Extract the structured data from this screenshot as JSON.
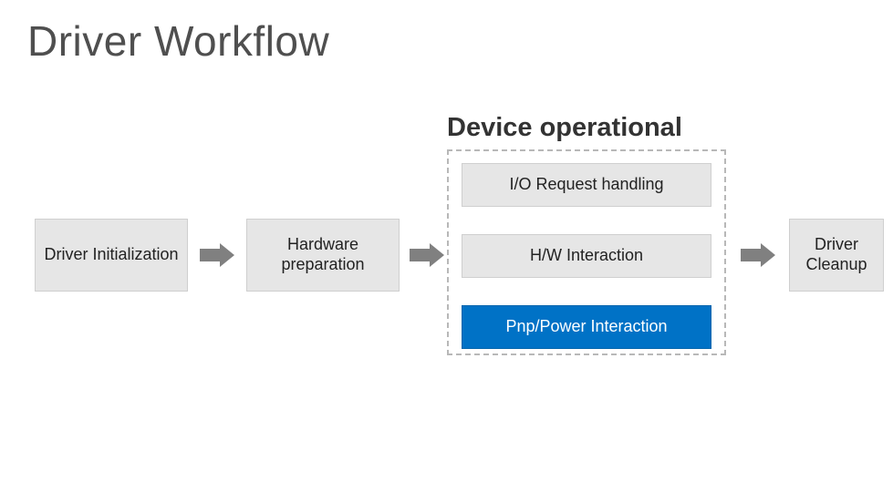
{
  "title": "Driver Workflow",
  "section_label": "Device operational",
  "boxes": {
    "driver_init": "Driver Initialization",
    "hw_prep": "Hardware preparation",
    "io_request": "I/O Request handling",
    "hw_interaction": "H/W Interaction",
    "pnp_power": "Pnp/Power Interaction",
    "cleanup": "Driver Cleanup"
  },
  "colors": {
    "gray_box": "#e6e6e6",
    "blue_box": "#0072c6",
    "arrow": "#808080",
    "dashed_border": "#b8b8b8"
  }
}
